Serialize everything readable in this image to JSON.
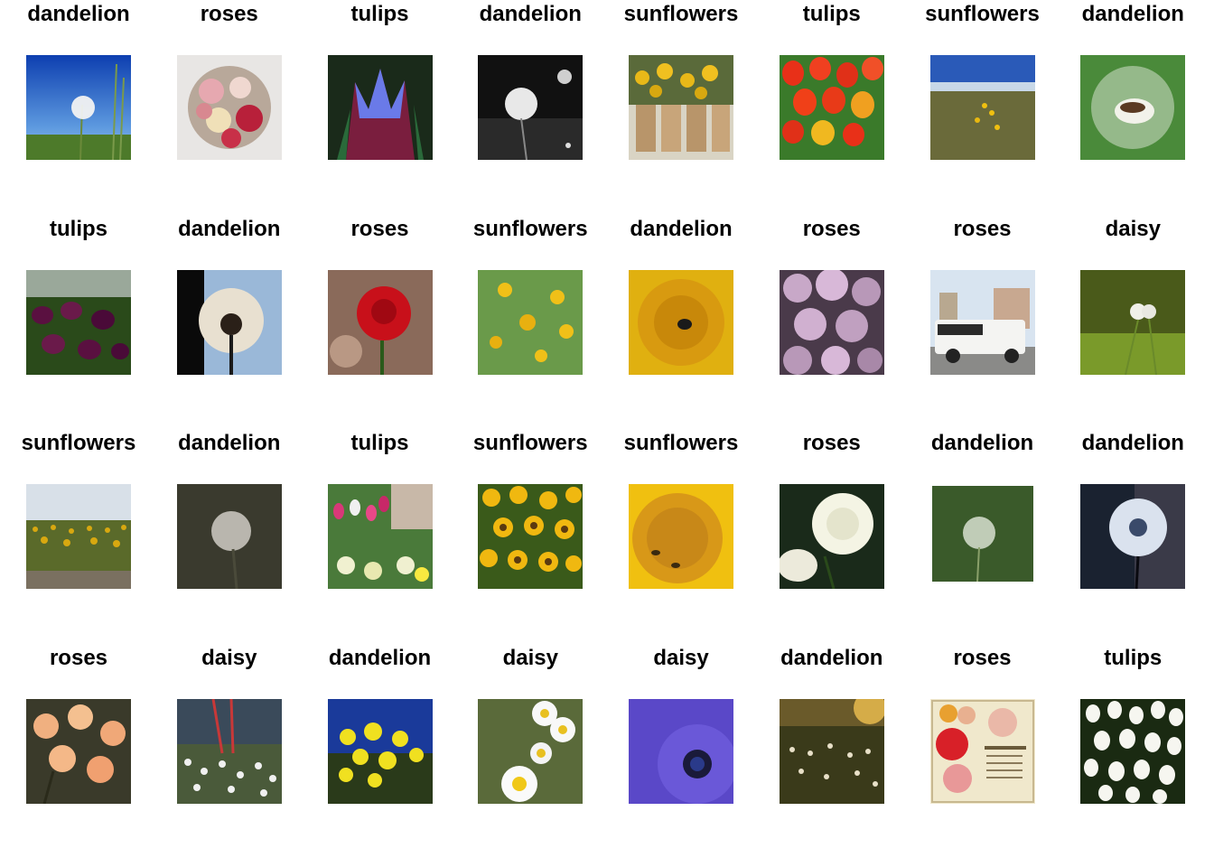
{
  "cols": 8,
  "images": [
    {
      "label": "dandelion",
      "scene": "dandelion-sky"
    },
    {
      "label": "roses",
      "scene": "rose-bouquet"
    },
    {
      "label": "tulips",
      "scene": "blue-tulip-closeup"
    },
    {
      "label": "dandelion",
      "scene": "dandelion-bw"
    },
    {
      "label": "sunflowers",
      "scene": "sunflower-stand"
    },
    {
      "label": "tulips",
      "scene": "red-tulips"
    },
    {
      "label": "sunflowers",
      "scene": "sunflower-meadow-sky"
    },
    {
      "label": "dandelion",
      "scene": "dandelion-macro-green"
    },
    {
      "label": "tulips",
      "scene": "purple-tulip-garden"
    },
    {
      "label": "dandelion",
      "scene": "dandelion-backlit"
    },
    {
      "label": "roses",
      "scene": "red-rose-single"
    },
    {
      "label": "sunflowers",
      "scene": "sunflower-field-green"
    },
    {
      "label": "dandelion",
      "scene": "yellow-flower-bee"
    },
    {
      "label": "roses",
      "scene": "pink-blossom-cluster"
    },
    {
      "label": "roses",
      "scene": "white-limousine"
    },
    {
      "label": "daisy",
      "scene": "daisy-bud-green"
    },
    {
      "label": "sunflowers",
      "scene": "sunflower-field-wide"
    },
    {
      "label": "dandelion",
      "scene": "dandelion-blurry"
    },
    {
      "label": "tulips",
      "scene": "tulip-flowerbed"
    },
    {
      "label": "sunflowers",
      "scene": "sunflower-dense"
    },
    {
      "label": "sunflowers",
      "scene": "sunflower-macro-bees"
    },
    {
      "label": "roses",
      "scene": "white-rose"
    },
    {
      "label": "dandelion",
      "scene": "dandelion-seedhead-green"
    },
    {
      "label": "dandelion",
      "scene": "dandelion-dusk"
    },
    {
      "label": "roses",
      "scene": "peach-roses"
    },
    {
      "label": "daisy",
      "scene": "daisy-garden-fence"
    },
    {
      "label": "dandelion",
      "scene": "yellow-flowers-bluesky"
    },
    {
      "label": "daisy",
      "scene": "white-daisies"
    },
    {
      "label": "daisy",
      "scene": "purple-daisy"
    },
    {
      "label": "dandelion",
      "scene": "dandelion-meadow-sunset"
    },
    {
      "label": "roses",
      "scene": "vintage-rose-catalog"
    },
    {
      "label": "tulips",
      "scene": "white-tulips"
    }
  ]
}
